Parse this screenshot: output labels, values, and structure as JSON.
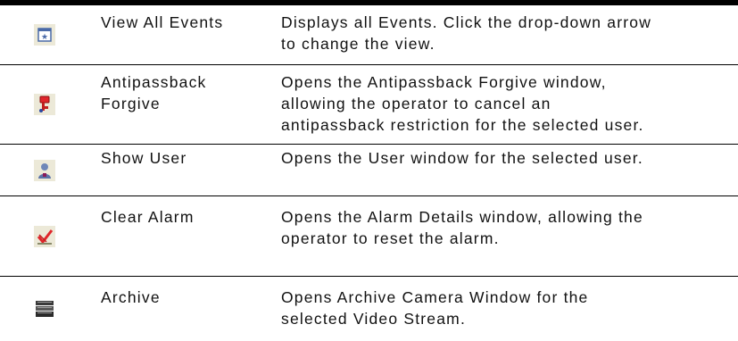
{
  "rows": [
    {
      "icon": "view-all-events-icon",
      "name_lines": [
        "View All Events"
      ],
      "desc_lines": [
        "Displays all Events. Click the drop-down arrow",
        "to change the view."
      ]
    },
    {
      "icon": "antipassback-forgive-icon",
      "name_lines": [
        "Antipassback",
        "Forgive"
      ],
      "desc_lines": [
        "Opens the Antipassback Forgive window,",
        "allowing the operator to cancel an",
        "antipassback restriction for the selected user."
      ]
    },
    {
      "icon": "show-user-icon",
      "name_lines": [
        "Show User"
      ],
      "desc_lines": [
        "Opens the User window for the selected user."
      ]
    },
    {
      "icon": "clear-alarm-icon",
      "name_lines": [
        "Clear Alarm"
      ],
      "desc_lines": [
        "Opens the Alarm Details window, allowing the",
        "operator to reset the alarm."
      ]
    },
    {
      "icon": "archive-icon",
      "name_lines": [
        "Archive"
      ],
      "desc_lines": [
        "Opens Archive Camera Window for the",
        "selected Video Stream."
      ]
    }
  ],
  "colors": {
    "rule": "#000000",
    "icon_bg": "#ece9d8",
    "accent_red": "#e0262b",
    "user_blue": "#6f87b8"
  }
}
